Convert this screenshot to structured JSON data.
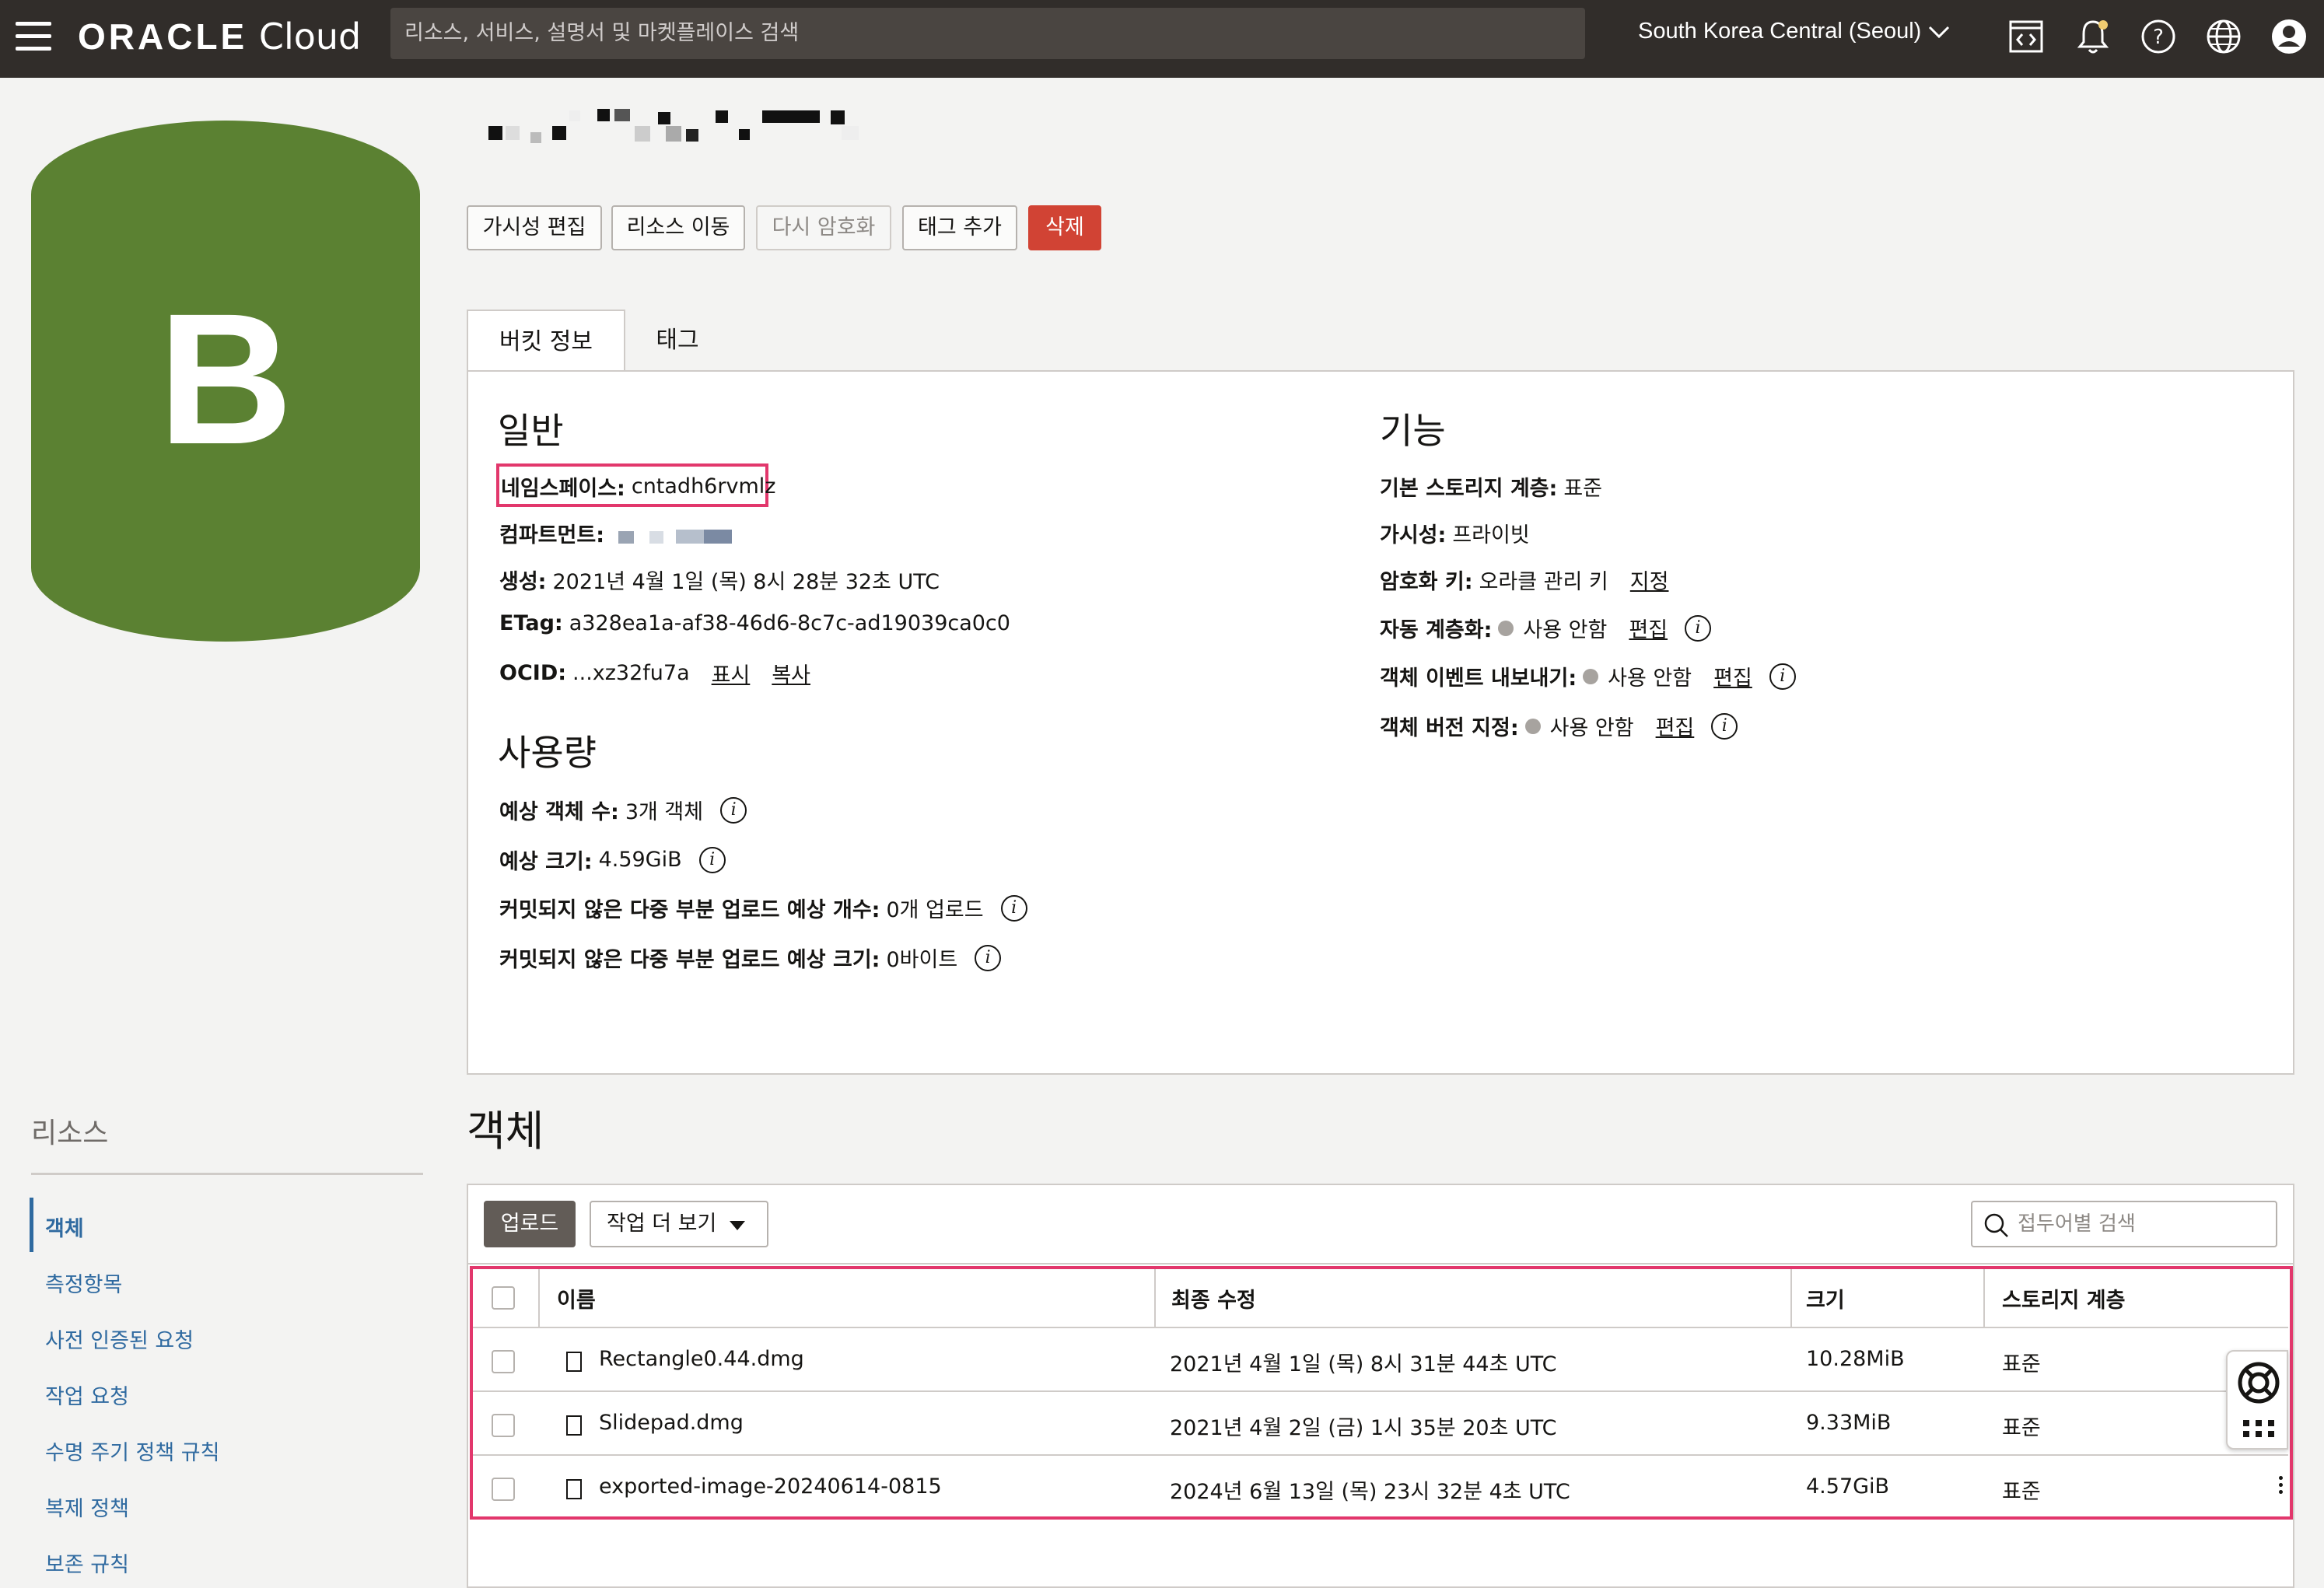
{
  "header": {
    "brand_oracle": "ORACLE",
    "brand_cloud": "Cloud",
    "search_placeholder": "리소스, 서비스, 설명서 및 마켓플레이스 검색",
    "region": "South Korea Central (Seoul)"
  },
  "avatar": {
    "letter": "B",
    "color": "#5b8132"
  },
  "actions": {
    "edit_visibility": "가시성 편집",
    "move_resource": "리소스 이동",
    "re_encrypt": "다시 암호화",
    "add_tags": "태그 추가",
    "delete": "삭제"
  },
  "tabs": {
    "bucket_info": "버킷 정보",
    "tags": "태그"
  },
  "general": {
    "title": "일반",
    "namespace_label": "네임스페이스:",
    "namespace_value": "cntadh6rvmlz",
    "compartment_label": "컴파트먼트:",
    "created_label": "생성:",
    "created_value": "2021년 4월 1일 (목) 8시 28분 32초 UTC",
    "etag_label": "ETag:",
    "etag_value": "a328ea1a-af38-46d6-8c7c-ad19039ca0c0",
    "ocid_label": "OCID:",
    "ocid_value": "...xz32fu7a",
    "ocid_show": "표시",
    "ocid_copy": "복사"
  },
  "usage": {
    "title": "사용량",
    "obj_count_label": "예상 객체 수:",
    "obj_count_value": "3개 객체",
    "size_label": "예상 크기:",
    "size_value": "4.59GiB",
    "mpu_count_label": "커밋되지 않은 다중 부분 업로드 예상 개수:",
    "mpu_count_value": "0개 업로드",
    "mpu_size_label": "커밋되지 않은 다중 부분 업로드 예상 크기:",
    "mpu_size_value": "0바이트"
  },
  "features": {
    "title": "기능",
    "tier_label": "기본 스토리지 계층:",
    "tier_value": "표준",
    "visibility_label": "가시성:",
    "visibility_value": "프라이빗",
    "encryption_label": "암호화 키:",
    "encryption_value": "오라클 관리 키",
    "encryption_link": "지정",
    "auto_tier_label": "자동 계층화:",
    "auto_tier_value": "사용 안함",
    "events_label": "객체 이벤트 내보내기:",
    "events_value": "사용 안함",
    "versioning_label": "객체 버전 지정:",
    "versioning_value": "사용 안함",
    "edit_link": "편집",
    "disabled_dot_color": "#a7a39f"
  },
  "resources": {
    "title": "리소스",
    "items": [
      "객체",
      "측정항목",
      "사전 인증된 요청",
      "작업 요청",
      "수명 주기 정책 규칙",
      "복제 정책",
      "보존 규칙"
    ]
  },
  "objects": {
    "title": "객체",
    "upload": "업로드",
    "more_actions": "작업 더 보기",
    "filter_placeholder": "접두어별 검색",
    "columns": [
      "이름",
      "최종 수정",
      "크기",
      "스토리지 계층"
    ],
    "rows": [
      {
        "name": "Rectangle0.44.dmg",
        "modified": "2021년 4월 1일 (목) 8시 31분 44초 UTC",
        "size": "10.28MiB",
        "tier": "표준"
      },
      {
        "name": "Slidepad.dmg",
        "modified": "2021년 4월 2일 (금) 1시 35분 20초 UTC",
        "size": "9.33MiB",
        "tier": "표준"
      },
      {
        "name": "exported-image-20240614-0815",
        "modified": "2024년 6월 13일 (목) 23시 32분 4초 UTC",
        "size": "4.57GiB",
        "tier": "표준"
      }
    ]
  },
  "colors": {
    "highlight": "#e2376c",
    "danger": "#d14334",
    "topbar": "#312d2a",
    "link": "#2f6aa0"
  }
}
